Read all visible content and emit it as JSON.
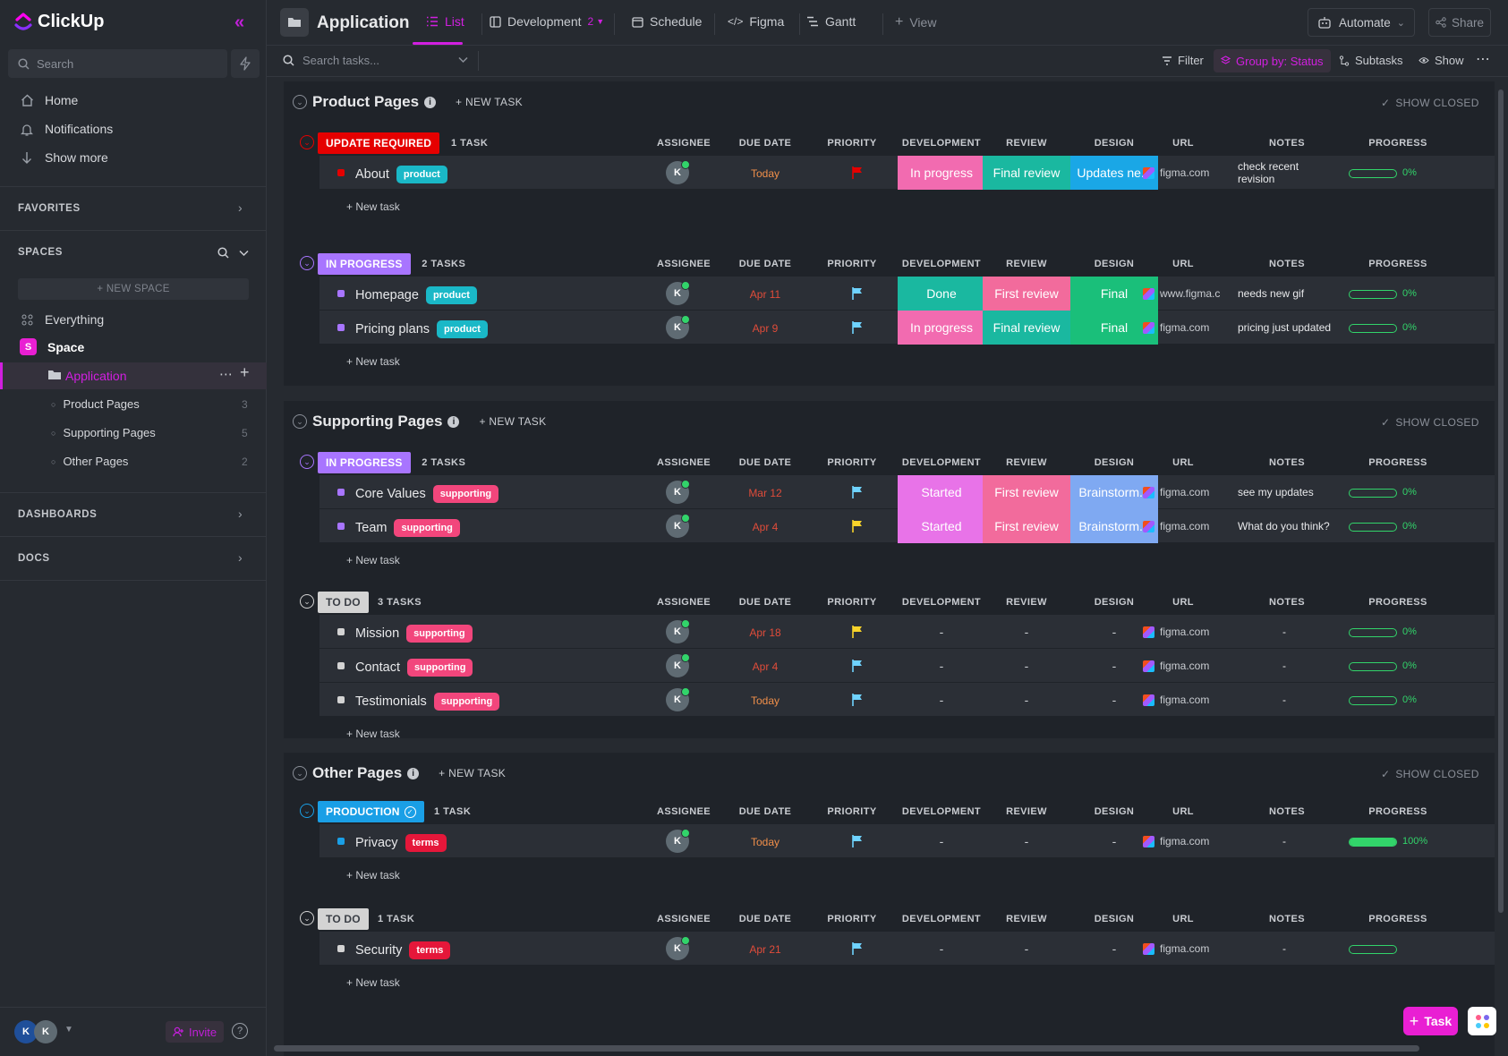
{
  "sidebar": {
    "logo": "ClickUp",
    "search_placeholder": "Search",
    "nav": [
      {
        "label": "Home",
        "icon": "home-icon"
      },
      {
        "label": "Notifications",
        "icon": "bell-icon"
      },
      {
        "label": "Show more",
        "icon": "arrow-down-icon"
      }
    ],
    "favorites": "FAVORITES",
    "spaces": "SPACES",
    "new_space": "+ NEW SPACE",
    "everything": "Everything",
    "space_name": "Space",
    "space_badge": "S",
    "folder": "Application",
    "lists": [
      {
        "label": "Product Pages",
        "count": "3"
      },
      {
        "label": "Supporting Pages",
        "count": "5"
      },
      {
        "label": "Other Pages",
        "count": "2"
      }
    ],
    "dashboards": "DASHBOARDS",
    "docs": "DOCS",
    "invite": "Invite",
    "avatars": [
      "K",
      "K"
    ]
  },
  "topbar": {
    "title": "Application",
    "tabs": [
      {
        "label": "List",
        "icon": "list-icon"
      },
      {
        "label": "Development",
        "icon": "board-icon",
        "badge": "2"
      },
      {
        "label": "Schedule",
        "icon": "calendar-icon"
      },
      {
        "label": "Figma",
        "icon": "code-icon"
      },
      {
        "label": "Gantt",
        "icon": "gantt-icon"
      },
      {
        "label": "View",
        "icon": "plus-icon"
      }
    ],
    "automate": "Automate",
    "share": "Share"
  },
  "toolbar": {
    "search_placeholder": "Search tasks...",
    "filter": "Filter",
    "group_by": "Group by: Status",
    "subtasks": "Subtasks",
    "show": "Show"
  },
  "columns": [
    "ASSIGNEE",
    "DUE DATE",
    "PRIORITY",
    "DEVELOPMENT",
    "REVIEW",
    "DESIGN",
    "URL",
    "NOTES",
    "PROGRESS"
  ],
  "sections": [
    {
      "title": "Product Pages",
      "new_task": "+ NEW TASK",
      "show_closed": "SHOW CLOSED",
      "groups": [
        {
          "status": "UPDATE REQUIRED",
          "status_color": "#e50000",
          "count_label": "1 TASK",
          "tasks": [
            {
              "name": "About",
              "tag": "product",
              "tag_color": "#1ab8c7",
              "dot": "#e50000",
              "assignee": "K",
              "due": "Today",
              "due_today": true,
              "priority": "#e50000",
              "dev": "In progress",
              "dev_color": "#f26bb0",
              "review": "Final review",
              "review_color": "#1ab8a0",
              "design": "Updates ne...",
              "design_color": "#1aa7e6",
              "url": "figma.com",
              "notes": "check recent revision",
              "progress": 0,
              "progress_label": "0%"
            }
          ]
        },
        {
          "status": "IN PROGRESS",
          "status_color": "#a875ff",
          "count_label": "2 TASKS",
          "tasks": [
            {
              "name": "Homepage",
              "tag": "product",
              "tag_color": "#1ab8c7",
              "dot": "#a875ff",
              "assignee": "K",
              "due": "Apr 11",
              "due_today": false,
              "priority": "#6fd3ff",
              "dev": "Done",
              "dev_color": "#1ab8a0",
              "review": "First review",
              "review_color": "#f26b9c",
              "design": "Final",
              "design_color": "#1abf7a",
              "url": "www.figma.c",
              "notes": "needs new gif",
              "progress": 0,
              "progress_label": "0%"
            },
            {
              "name": "Pricing plans",
              "tag": "product",
              "tag_color": "#1ab8c7",
              "dot": "#a875ff",
              "assignee": "K",
              "due": "Apr 9",
              "due_today": false,
              "priority": "#6fd3ff",
              "dev": "In progress",
              "dev_color": "#f26bb0",
              "review": "Final review",
              "review_color": "#1ab8a0",
              "design": "Final",
              "design_color": "#1abf7a",
              "url": "figma.com",
              "notes": "pricing just updated",
              "progress": 0,
              "progress_label": "0%"
            }
          ]
        }
      ]
    },
    {
      "title": "Supporting Pages",
      "new_task": "+ NEW TASK",
      "show_closed": "SHOW CLOSED",
      "groups": [
        {
          "status": "IN PROGRESS",
          "status_color": "#a875ff",
          "count_label": "2 TASKS",
          "tasks": [
            {
              "name": "Core Values",
              "tag": "supporting",
              "tag_color": "#f2467c",
              "dot": "#a875ff",
              "assignee": "K",
              "due": "Mar 12",
              "due_today": false,
              "priority": "#6fd3ff",
              "dev": "Started",
              "dev_color": "#e873e8",
              "review": "First review",
              "review_color": "#f26b9c",
              "design": "Brainstorm...",
              "design_color": "#7fa9f2",
              "url": "figma.com",
              "notes": "see my updates",
              "progress": 0,
              "progress_label": "0%"
            },
            {
              "name": "Team",
              "tag": "supporting",
              "tag_color": "#f2467c",
              "dot": "#a875ff",
              "assignee": "K",
              "due": "Apr 4",
              "due_today": false,
              "priority": "#f7d32a",
              "dev": "Started",
              "dev_color": "#e873e8",
              "review": "First review",
              "review_color": "#f26b9c",
              "design": "Brainstorm...",
              "design_color": "#7fa9f2",
              "url": "figma.com",
              "notes": "What do you think?",
              "progress": 0,
              "progress_label": "0%"
            }
          ]
        },
        {
          "status": "TO DO",
          "status_color": "#d3d3d3",
          "count_label": "3 TASKS",
          "tasks": [
            {
              "name": "Mission",
              "tag": "supporting",
              "tag_color": "#f2467c",
              "dot": "#d3d3d3",
              "assignee": "K",
              "due": "Apr 18",
              "due_today": false,
              "priority": "#f7d32a",
              "dev": "-",
              "review": "-",
              "design": "-",
              "url": "figma.com",
              "notes": "-",
              "progress": 0,
              "progress_label": "0%"
            },
            {
              "name": "Contact",
              "tag": "supporting",
              "tag_color": "#f2467c",
              "dot": "#d3d3d3",
              "assignee": "K",
              "due": "Apr 4",
              "due_today": false,
              "priority": "#6fd3ff",
              "dev": "-",
              "review": "-",
              "design": "-",
              "url": "figma.com",
              "notes": "-",
              "progress": 0,
              "progress_label": "0%"
            },
            {
              "name": "Testimonials",
              "tag": "supporting",
              "tag_color": "#f2467c",
              "dot": "#d3d3d3",
              "assignee": "K",
              "due": "Today",
              "due_today": true,
              "priority": "#6fd3ff",
              "dev": "-",
              "review": "-",
              "design": "-",
              "url": "figma.com",
              "notes": "-",
              "progress": 0,
              "progress_label": "0%"
            }
          ]
        }
      ]
    },
    {
      "title": "Other Pages",
      "new_task": "+ NEW TASK",
      "show_closed": "SHOW CLOSED",
      "groups": [
        {
          "status": "PRODUCTION",
          "status_color": "#1a9fe6",
          "count_label": "1 TASK",
          "check": true,
          "tasks": [
            {
              "name": "Privacy",
              "tag": "terms",
              "tag_color": "#e5173a",
              "dot": "#1a9fe6",
              "assignee": "K",
              "due": "Today",
              "due_today": true,
              "priority": "#6fd3ff",
              "dev": "-",
              "review": "-",
              "design": "-",
              "url": "figma.com",
              "notes": "-",
              "progress": 100,
              "progress_label": "100%"
            }
          ]
        },
        {
          "status": "TO DO",
          "status_color": "#d3d3d3",
          "count_label": "1 TASK",
          "tasks": [
            {
              "name": "Security",
              "tag": "terms",
              "tag_color": "#e5173a",
              "dot": "#d3d3d3",
              "assignee": "K",
              "due": "Apr 21",
              "due_today": false,
              "priority": "#6fd3ff",
              "dev": "-",
              "review": "-",
              "design": "-",
              "url": "figma.com",
              "notes": "-",
              "progress": 0,
              "progress_label": ""
            }
          ]
        }
      ]
    }
  ],
  "new_task_row": "+ New task",
  "fab_label": "Task"
}
